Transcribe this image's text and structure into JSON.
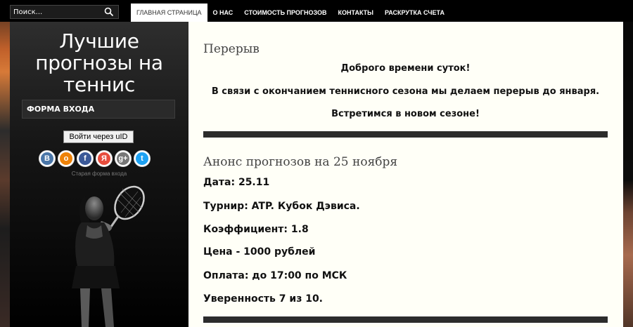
{
  "search": {
    "placeholder": "Поиск..."
  },
  "nav": {
    "items": [
      "Главная страница",
      "О нас",
      "Стоимость прогнозов",
      "Контакты",
      "Раскрутка счета"
    ],
    "active_index": 0
  },
  "sidebar": {
    "site_title": "Лучшие\nпрогнозы на\nтеннис",
    "login_header": "ФОРМА ВХОДА",
    "uid_button": "Войти через uID",
    "social": [
      {
        "name": "vkontakte",
        "letter": "В",
        "color": "#4a76a8"
      },
      {
        "name": "odnoklassniki",
        "letter": "о",
        "color": "#ee8208"
      },
      {
        "name": "facebook",
        "letter": "f",
        "color": "#3b5998"
      },
      {
        "name": "yandex",
        "letter": "Я",
        "color": "#e74c3c"
      },
      {
        "name": "google-plus",
        "letter": "g+",
        "color": "#777777"
      },
      {
        "name": "twitter",
        "letter": "t",
        "color": "#1da1f2"
      }
    ],
    "old_login": "Старая форма входа"
  },
  "posts": [
    {
      "title": "Перерыв",
      "lines": [
        "Доброго времени суток!",
        "В связи с окончанием теннисного сезона мы делаем перерыв до января.",
        "Встретимся в новом сезоне!"
      ]
    },
    {
      "title": "Анонс прогнозов на 25 ноября",
      "details": [
        "Дата: 25.11",
        "Турнир: ATP. Кубок Дэвиса.",
        "Коэффициент: 1.8",
        "Цена - 1000 рублей",
        "Оплата: до 17:00 по МСК",
        "Уверенность 7 из 10."
      ]
    }
  ]
}
